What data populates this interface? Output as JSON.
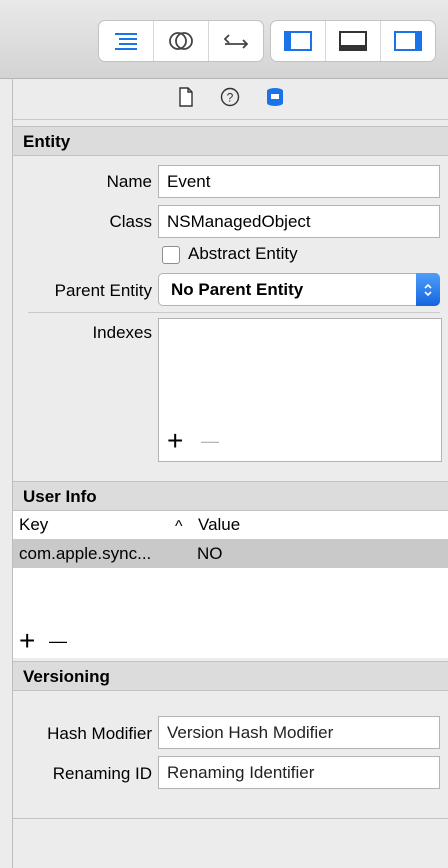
{
  "toolbar": {
    "left_segment": [
      "navigator-icon",
      "assistant-icon",
      "version-icon"
    ],
    "right_segment": [
      "left-panel-icon",
      "bottom-panel-icon",
      "right-panel-icon"
    ]
  },
  "inspector_tabs": [
    "file-icon",
    "help-icon",
    "data-model-icon"
  ],
  "entity": {
    "section_title": "Entity",
    "name_label": "Name",
    "name_value": "Event",
    "class_label": "Class",
    "class_value": "NSManagedObject",
    "abstract_label": "Abstract Entity",
    "abstract_checked": false,
    "parent_label": "Parent Entity",
    "parent_value": "No Parent Entity",
    "indexes_label": "Indexes",
    "indexes_add": "+",
    "indexes_remove": "—"
  },
  "user_info": {
    "section_title": "User Info",
    "col_key": "Key",
    "col_sort": "^",
    "col_value": "Value",
    "rows": [
      {
        "key": "com.apple.sync...",
        "value": "NO"
      }
    ],
    "add": "+",
    "remove": "—"
  },
  "versioning": {
    "section_title": "Versioning",
    "hash_label": "Hash Modifier",
    "hash_placeholder": "Version Hash Modifier",
    "renaming_label": "Renaming ID",
    "renaming_placeholder": "Renaming Identifier"
  },
  "colors": {
    "accent": "#1a73e8",
    "selected_row": "#c9c9c9"
  }
}
